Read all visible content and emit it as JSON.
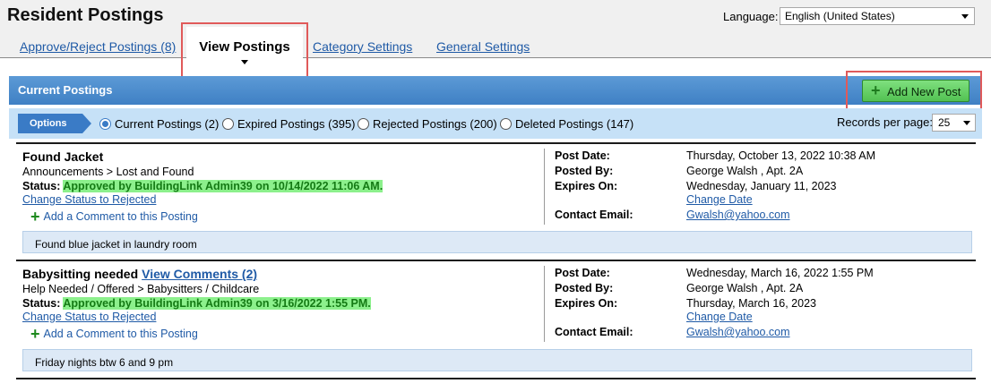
{
  "page": {
    "title": "Resident Postings"
  },
  "language": {
    "label": "Language:",
    "selected": "English (United States)"
  },
  "tabs": {
    "approve_reject": "Approve/Reject Postings (8)",
    "view_postings": "View Postings",
    "category_settings": "Category Settings",
    "general_settings": "General Settings"
  },
  "header": {
    "title": "Current Postings",
    "add_button": "Add New Post"
  },
  "filters": {
    "options_label": "Options",
    "current": "Current Postings (2)",
    "expired": "Expired Postings (395)",
    "rejected": "Rejected Postings (200)",
    "deleted": "Deleted Postings (147)",
    "records_label": "Records per page:",
    "records_value": "25"
  },
  "labels": {
    "status": "Status:",
    "change_status": "Change Status to Rejected",
    "add_comment": "Add a Comment to this Posting",
    "post_date": "Post Date:",
    "posted_by": "Posted By:",
    "expires_on": "Expires On:",
    "change_date": "Change Date",
    "contact_email": "Contact Email:"
  },
  "posts": [
    {
      "title": "Found Jacket",
      "view_comments": "",
      "category": "Announcements > Lost and Found",
      "status": "Approved by BuildingLink Admin39 on 10/14/2022 11:06 AM.",
      "post_date": "Thursday, October 13, 2022 10:38 AM",
      "posted_by": "George Walsh , Apt. 2A",
      "expires_on": "Wednesday, January 11, 2023",
      "email": "Gwalsh@yahoo.com",
      "description": "Found blue jacket in laundry room"
    },
    {
      "title": "Babysitting needed",
      "view_comments": "View  Comments (2) ",
      "category": "Help Needed / Offered > Babysitters / Childcare",
      "status": "Approved by BuildingLink Admin39 on 3/16/2022 1:55 PM.",
      "post_date": "Wednesday, March 16, 2022 1:55 PM",
      "posted_by": "George Walsh , Apt. 2A",
      "expires_on": "Thursday, March 16, 2023",
      "email": "Gwalsh@yahoo.com",
      "description": "Friday nights btw 6 and 9 pm"
    }
  ],
  "colors": {
    "header_blue": "#3f80c4",
    "filter_blue": "#c6e1f7",
    "status_green_bg": "#8cf08c",
    "link_blue": "#1f5aa6",
    "highlight_red": "#e05a5a",
    "add_button_green": "#52c152"
  },
  "icons": {
    "add_post": "plus-icon",
    "add_comment": "plus-icon",
    "dropdown": "chevron-down-icon"
  }
}
